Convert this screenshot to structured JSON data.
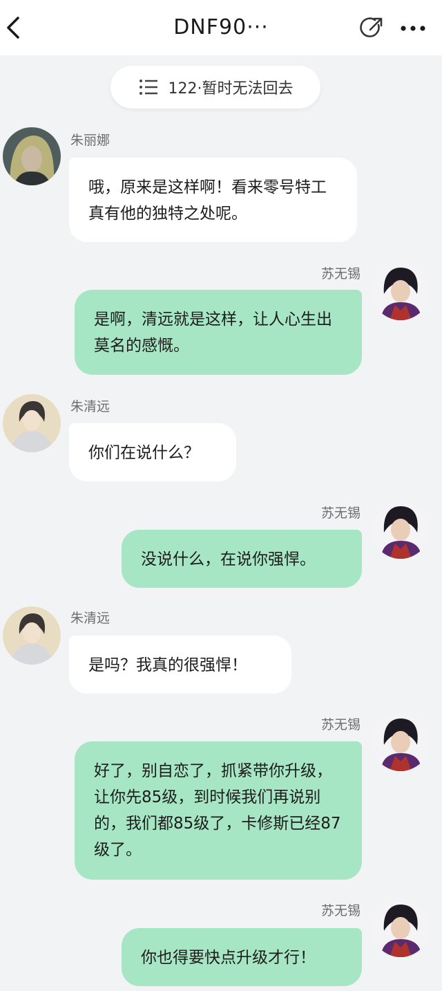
{
  "header": {
    "title": "DNF90",
    "title_ellipsis": "···",
    "back_icon": "chevron-left-icon",
    "share_icon": "share-icon",
    "more_icon": "more-dots-icon"
  },
  "group_banner": {
    "icon": "list-icon",
    "text": "122·暂时无法回去"
  },
  "messages": [
    {
      "sender": "朱丽娜",
      "side": "left",
      "text": "哦，原来是这样啊！看来零号特工真有他的独特之处呢。"
    },
    {
      "sender": "苏无锡",
      "side": "right",
      "text": "是啊，清远就是这样，让人心生出莫名的感慨。"
    },
    {
      "sender": "朱清远",
      "side": "left",
      "text": "你们在说什么？"
    },
    {
      "sender": "苏无锡",
      "side": "right",
      "text": "没说什么，在说你强悍。"
    },
    {
      "sender": "朱清远",
      "side": "left",
      "text": "是吗？我真的很强悍！"
    },
    {
      "sender": "苏无锡",
      "side": "right",
      "text": "好了，别自恋了，抓紧带你升级，让你先85级，到时候我们再说别的，我们都85级了，卡修斯已经87级了。"
    },
    {
      "sender": "苏无锡",
      "side": "right",
      "text": "你也得要快点升级才行！"
    }
  ],
  "colors": {
    "background": "#f2f3f5",
    "bubble_self": "#a7e6c4",
    "bubble_other": "#ffffff"
  }
}
